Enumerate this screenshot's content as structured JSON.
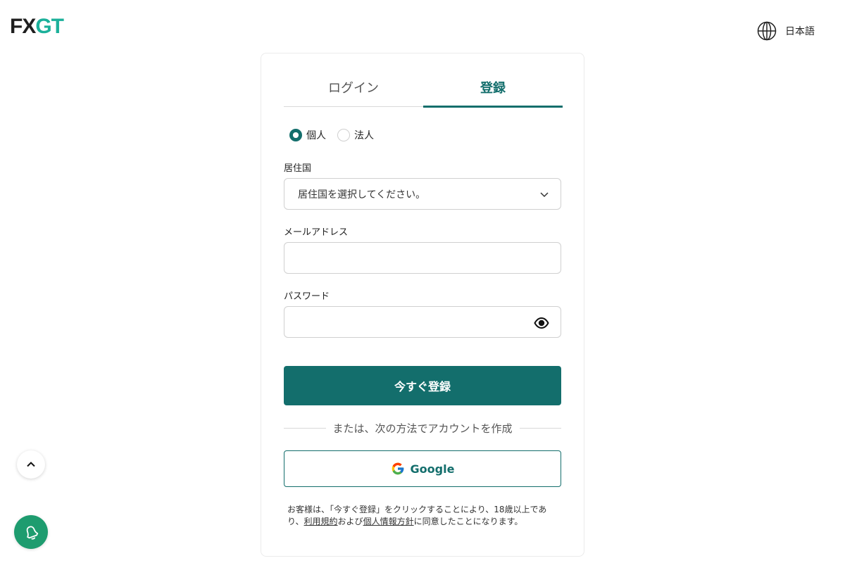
{
  "header": {
    "logo_fx": "FX",
    "logo_gt": "GT",
    "language_label": "日本語"
  },
  "tabs": [
    {
      "label": "ログイン",
      "active": false
    },
    {
      "label": "登録",
      "active": true
    }
  ],
  "account_type": {
    "options": [
      "個人",
      "法人"
    ],
    "selected": "個人"
  },
  "form": {
    "country_label": "居住国",
    "country_placeholder": "居住国を選択してください。",
    "email_label": "メールアドレス",
    "email_value": "",
    "password_label": "パスワード",
    "password_value": "",
    "submit_label": "今すぐ登録"
  },
  "social": {
    "divider_text": "または、次の方法でアカウントを作成",
    "google_label": "Google"
  },
  "legal": {
    "prefix": "お客様は、「今すぐ登録」をクリックすることにより、18歳以上であり、",
    "terms_link": "利用規約",
    "middle": "および",
    "privacy_link": "個人情報方針",
    "suffix": "に同意したことになります。"
  },
  "colors": {
    "primary": "#136e6c",
    "logo_accent": "#1bb09a",
    "notify": "#1e9c6f"
  },
  "icons": [
    "globe-icon",
    "chevron-down-icon",
    "eye-icon",
    "google-icon",
    "chevron-up-icon",
    "bell-icon"
  ]
}
